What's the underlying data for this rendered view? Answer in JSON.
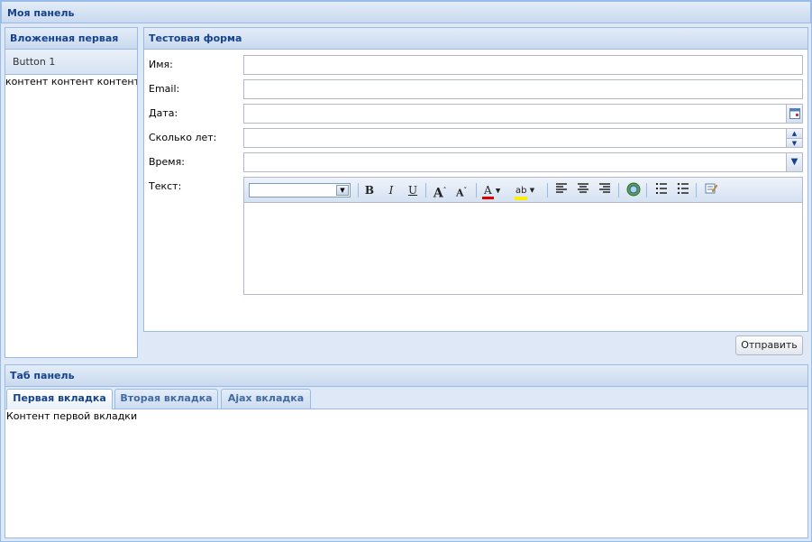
{
  "root": {
    "title": "Моя панель"
  },
  "nested": {
    "title": "Вложенная первая",
    "button_label": "Button 1",
    "content": "контент контент контент"
  },
  "form": {
    "title": "Тестовая форма",
    "fields": [
      {
        "label": "Имя:",
        "value": ""
      },
      {
        "label": "Email:",
        "value": ""
      },
      {
        "label": "Дата:",
        "value": ""
      },
      {
        "label": "Сколько лет:",
        "value": ""
      },
      {
        "label": "Время:",
        "value": ""
      },
      {
        "label": "Текст:",
        "value": ""
      }
    ],
    "editor_toolbar": {
      "font_family": "",
      "bold": "B",
      "italic": "I",
      "underline": "U",
      "grow_font": "A",
      "shrink_font": "A",
      "font_color": "A",
      "highlight": "ab"
    },
    "submit_label": "Отправить"
  },
  "tabs": {
    "title": "Таб панель",
    "items": [
      {
        "label": "Первая вкладка",
        "active": true
      },
      {
        "label": "Вторая вкладка",
        "active": false
      },
      {
        "label": "Ajax вкладка",
        "active": false
      }
    ],
    "active_content": "Контент первой вкладки"
  },
  "colors": {
    "header_text": "#15428b",
    "border": "#99bbe8",
    "background": "#dfe8f6"
  }
}
